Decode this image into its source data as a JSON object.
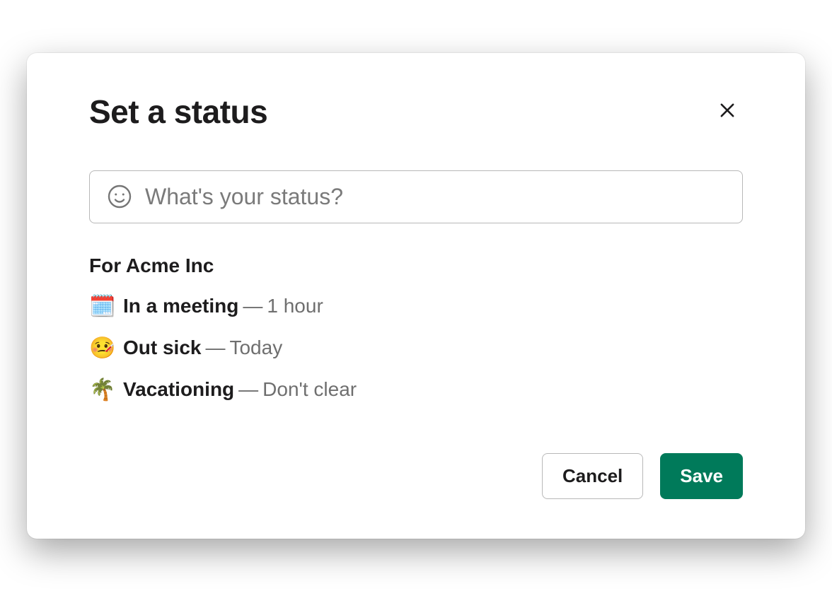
{
  "modal": {
    "title": "Set a status",
    "input_placeholder": "What's your status?",
    "input_value": "",
    "org_label": "For Acme Inc",
    "presets": [
      {
        "emoji": "🗓️",
        "label": "In a meeting",
        "duration": "1 hour"
      },
      {
        "emoji": "🤒",
        "label": "Out sick",
        "duration": "Today"
      },
      {
        "emoji": "🌴",
        "label": "Vacationing",
        "duration": "Don't clear"
      }
    ],
    "separator": " — ",
    "cancel_label": "Cancel",
    "save_label": "Save"
  }
}
